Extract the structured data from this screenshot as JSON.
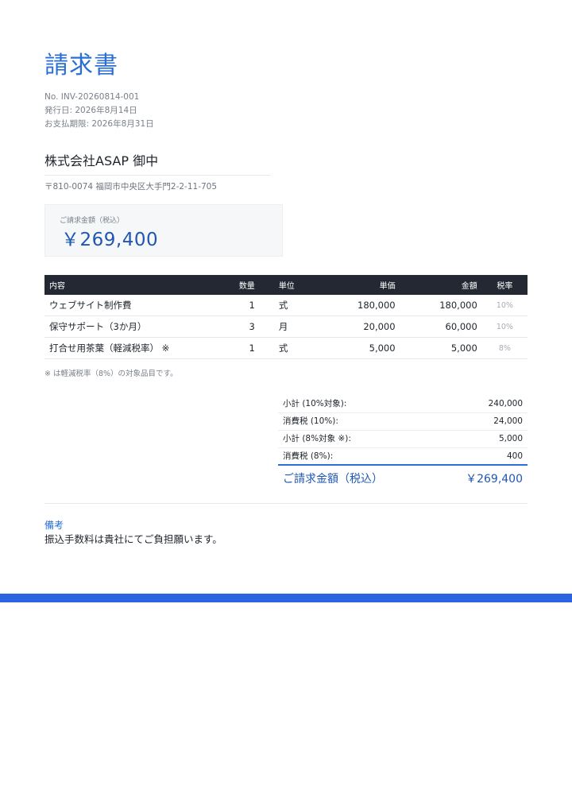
{
  "header": {
    "title": "請求書",
    "invoice_no": "No. INV-20260814-001",
    "issue_date": "発行日: 2026年8月14日",
    "due_date": "お支払期限: 2026年8月31日"
  },
  "recipient": {
    "name": "株式会社ASAP 御中",
    "address": "〒810-0074 福岡市中央区大手門2-2-11-705"
  },
  "amount_box": {
    "label": "ご請求金額（税込）",
    "value": "￥269,400"
  },
  "table": {
    "headers": {
      "name": "内容",
      "qty": "数量",
      "unit": "単位",
      "price": "単価",
      "amount": "金額",
      "rate": "税率"
    },
    "rows": [
      {
        "name": "ウェブサイト制作費",
        "qty": "1",
        "unit": "式",
        "price": "180,000",
        "amount": "180,000",
        "rate": "10%"
      },
      {
        "name": "保守サポート（3か月）",
        "qty": "3",
        "unit": "月",
        "price": "20,000",
        "amount": "60,000",
        "rate": "10%"
      },
      {
        "name": "打合せ用茶葉（軽減税率） ※",
        "qty": "1",
        "unit": "式",
        "price": "5,000",
        "amount": "5,000",
        "rate": "8%"
      }
    ]
  },
  "note": "※ は軽減税率（8%）の対象品目です。",
  "summary": {
    "rows": [
      {
        "label": "小計 (10%対象):",
        "value": "240,000"
      },
      {
        "label": "消費税 (10%):",
        "value": "24,000"
      },
      {
        "label": "小計 (8%対象 ※):",
        "value": "5,000"
      },
      {
        "label": "消費税 (8%):",
        "value": "400"
      }
    ],
    "total_label": "ご請求金額（税込）",
    "total_value": "￥269,400"
  },
  "remarks": {
    "heading": "備考",
    "body": "振込手数料は貴社にてご負担願います。"
  },
  "colors": {
    "accent": "#2a6fd6",
    "table_header": "#232833",
    "bottom_bar": "#2b63e0"
  }
}
